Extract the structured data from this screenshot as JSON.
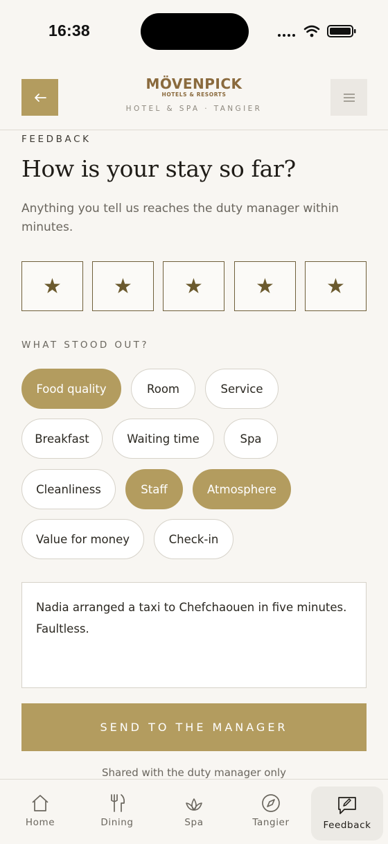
{
  "status_bar": {
    "time": "16:38"
  },
  "header": {
    "logo_word": "MÖVENPICK",
    "logo_sub": "HOTELS & RESORTS",
    "logo_place": "HOTEL & SPA · TANGIER"
  },
  "main": {
    "eyebrow": "FEEDBACK",
    "title": "How is your stay so far?",
    "subtitle": "Anything you tell us reaches the duty manager within minutes.",
    "rating": {
      "stars": 5,
      "glyph": "★"
    },
    "section_label": "WHAT STOOD OUT?",
    "chips": [
      {
        "label": "Food quality",
        "selected": true
      },
      {
        "label": "Room",
        "selected": false
      },
      {
        "label": "Service",
        "selected": false
      },
      {
        "label": "Breakfast",
        "selected": false
      },
      {
        "label": "Waiting time",
        "selected": false
      },
      {
        "label": "Spa",
        "selected": false
      },
      {
        "label": "Cleanliness",
        "selected": false
      },
      {
        "label": "Staff",
        "selected": true
      },
      {
        "label": "Atmosphere",
        "selected": true
      },
      {
        "label": "Value for money",
        "selected": false
      },
      {
        "label": "Check-in",
        "selected": false
      }
    ],
    "comment": "Nadia arranged a taxi to Chefchaouen in five minutes. Faultless.",
    "send_label": "SEND TO THE MANAGER",
    "footnote": "Shared with the duty manager only"
  },
  "tabbar": {
    "items": [
      {
        "label": "Home",
        "icon": "home-icon",
        "active": false
      },
      {
        "label": "Dining",
        "icon": "utensils-icon",
        "active": false
      },
      {
        "label": "Spa",
        "icon": "lotus-icon",
        "active": false
      },
      {
        "label": "Tangier",
        "icon": "compass-icon",
        "active": false
      },
      {
        "label": "Feedback",
        "icon": "feedback-icon",
        "active": true
      }
    ]
  },
  "colors": {
    "accent": "#b39c5f",
    "background": "#f8f6f2",
    "star": "#6b5a2e"
  }
}
